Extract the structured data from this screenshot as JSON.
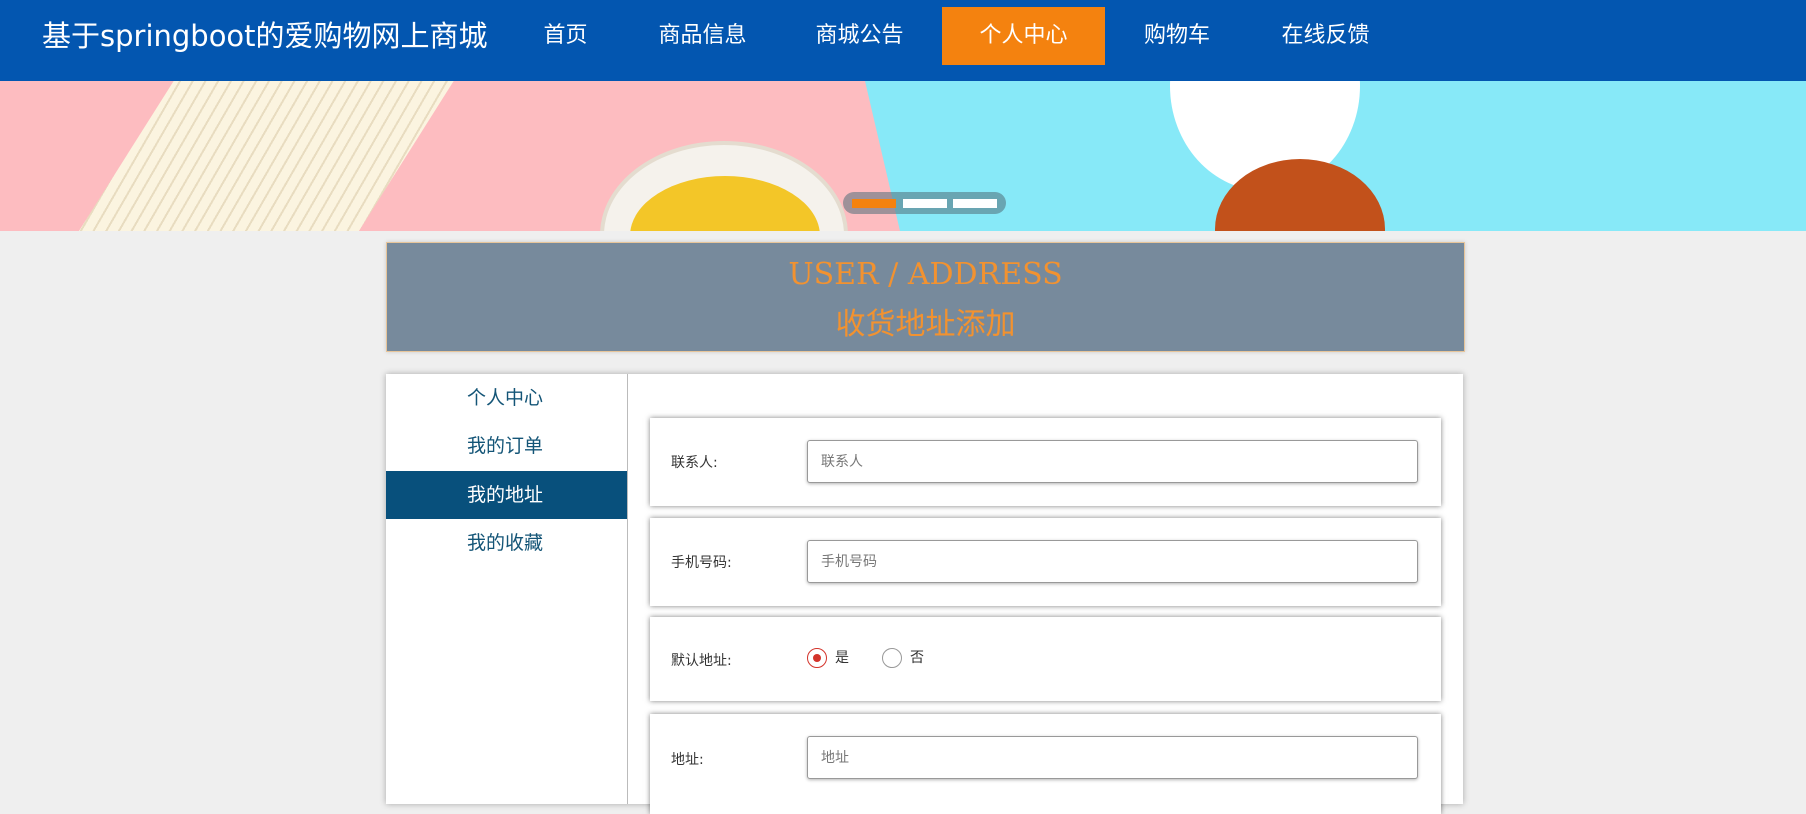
{
  "header": {
    "brand": "基于springboot的爱购物网上商城",
    "menu": [
      {
        "label": "首页"
      },
      {
        "label": "商品信息"
      },
      {
        "label": "商城公告"
      },
      {
        "label": "个人中心",
        "active": true
      },
      {
        "label": "购物车"
      },
      {
        "label": "在线反馈"
      }
    ]
  },
  "banner": {
    "slides": 3,
    "active_slide": 1
  },
  "title": {
    "en": "USER / ADDRESS",
    "cn": "收货地址添加"
  },
  "sidebar": {
    "items": [
      {
        "label": "个人中心"
      },
      {
        "label": "我的订单"
      },
      {
        "label": "我的地址",
        "active": true
      },
      {
        "label": "我的收藏"
      }
    ]
  },
  "form": {
    "contact": {
      "label": "联系人:",
      "placeholder": "联系人",
      "value": ""
    },
    "phone": {
      "label": "手机号码:",
      "placeholder": "手机号码",
      "value": ""
    },
    "default": {
      "label": "默认地址:",
      "options": [
        "是",
        "否"
      ],
      "selected": "是"
    },
    "address": {
      "label": "地址:",
      "placeholder": "地址",
      "value": ""
    }
  },
  "colors": {
    "nav_bg": "#0356b0",
    "nav_active": "#f4820f",
    "title_bg": "#778a9c",
    "title_text": "#f29230",
    "sidebar_active": "#08507c",
    "radio_on": "#d3332a"
  }
}
